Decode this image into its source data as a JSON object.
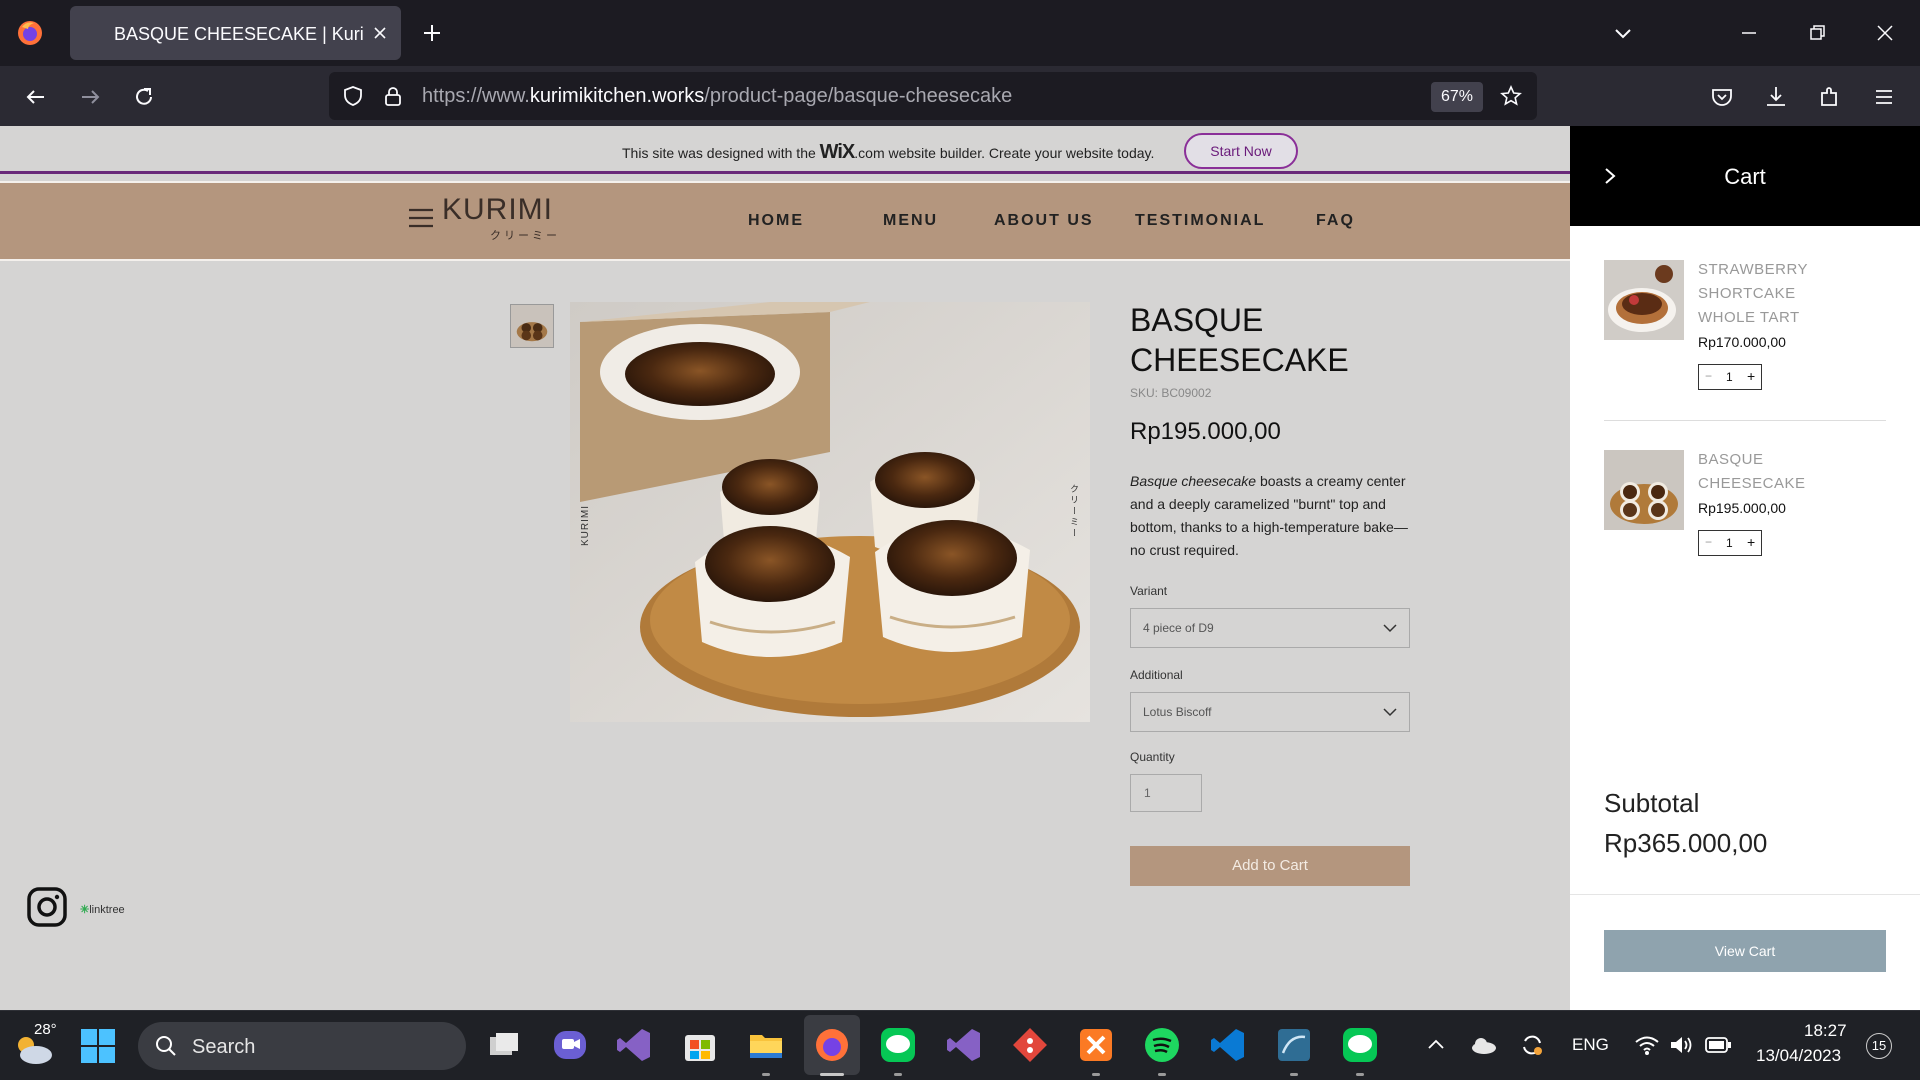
{
  "browser": {
    "tab_title": "BASQUE CHEESECAKE | Kurimi K",
    "url_prefix": "https://www.",
    "url_host": "kurimikitchen.works",
    "url_path": "/product-page/basque-cheesecake",
    "zoom": "67%"
  },
  "wix_banner": {
    "text_before": "This site was designed with the",
    "brand": "WiX",
    "text_after": ".com website builder. Create your website today.",
    "button": "Start Now"
  },
  "site": {
    "logo": "KURIMI",
    "logo_sub": "クリーミー",
    "nav": [
      "HOME",
      "MENU",
      "ABOUT US",
      "TESTIMONIAL",
      "FAQ"
    ]
  },
  "product": {
    "title": "BASQUE CHEESECAKE",
    "sku": "SKU: BC09002",
    "price": "Rp195.000,00",
    "desc_italic": "Basque cheesecake",
    "desc_rest": " boasts a creamy center and a deeply caramelized \"burnt\" top and bottom, thanks to a high-temperature bake—no crust required.",
    "variant_label": "Variant",
    "variant_value": "4 piece of D9",
    "additional_label": "Additional",
    "additional_value": "Lotus Biscoff",
    "quantity_label": "Quantity",
    "quantity_value": "1",
    "add_to_cart": "Add to Cart",
    "photo_side_left": "KURIMI",
    "photo_side_right": "クリーミー"
  },
  "social": {
    "linktree": "linktree"
  },
  "cart": {
    "title": "Cart",
    "items": [
      {
        "name": "STRAWBERRY SHORTCAKE WHOLE TART",
        "price": "Rp170.000,00",
        "qty": "1"
      },
      {
        "name": "BASQUE CHEESECAKE",
        "price": "Rp195.000,00",
        "qty": "1"
      }
    ],
    "subtotal_label": "Subtotal",
    "subtotal_value": "Rp365.000,00",
    "view_cart": "View Cart"
  },
  "taskbar": {
    "temperature": "28°",
    "search": "Search",
    "lang": "ENG",
    "time": "18:27",
    "date": "13/04/2023",
    "notifications": "15"
  },
  "colors": {
    "accent_wix": "#8a2f98",
    "header_tan": "#b4967e",
    "page_bg": "#d5d4d3",
    "view_cart_blue": "#8fa3ae"
  }
}
